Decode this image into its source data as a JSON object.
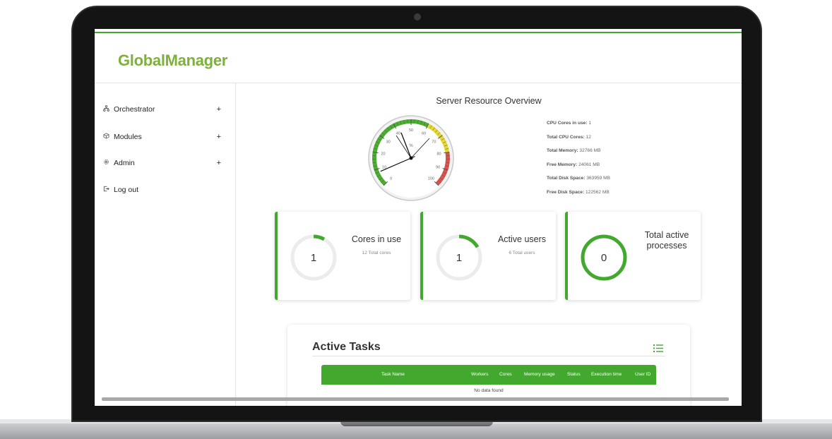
{
  "app": {
    "name": "GlobalManager"
  },
  "sidebar": {
    "items": [
      {
        "label": "Orchestrator",
        "expand": "+",
        "icon": "sitemap-icon"
      },
      {
        "label": "Modules",
        "expand": "+",
        "icon": "cube-icon"
      },
      {
        "label": "Admin",
        "expand": "+",
        "icon": "gear-icon"
      },
      {
        "label": "Log out",
        "icon": "logout-icon"
      }
    ]
  },
  "overview": {
    "title": "Server Resource Overview",
    "gauge": {
      "unit": "%",
      "ticks": [
        "0",
        "10",
        "20",
        "30",
        "40",
        "50",
        "60",
        "70",
        "80",
        "90",
        "100"
      ],
      "value_percent": 8
    },
    "stats": [
      {
        "label": "CPU Cores in use:",
        "value": "1"
      },
      {
        "label": "Total CPU Cores:",
        "value": "12"
      },
      {
        "label": "Total Memory:",
        "value": "32766 MB"
      },
      {
        "label": "Free Memory:",
        "value": "24061 MB"
      },
      {
        "label": "Total Disk Space:",
        "value": "363959 MB"
      },
      {
        "label": "Free Disk Space:",
        "value": "122562 MB"
      }
    ]
  },
  "cards": [
    {
      "label": "Cores in use",
      "value": "1",
      "sub": "12 Total cores",
      "fraction": 0.083
    },
    {
      "label": "Active users",
      "value": "1",
      "sub": "6 Total users",
      "fraction": 0.167
    },
    {
      "label": "Total active processes",
      "value": "0",
      "sub": "",
      "fraction": 1
    }
  ],
  "tasks": {
    "title": "Active Tasks",
    "columns": [
      "Task Name",
      "Workers",
      "Cores",
      "Memory usage",
      "Status",
      "Execution time",
      "User ID"
    ],
    "empty_text": "No data found"
  },
  "colors": {
    "accent": "#43a92e",
    "logo": "#7db13a"
  }
}
